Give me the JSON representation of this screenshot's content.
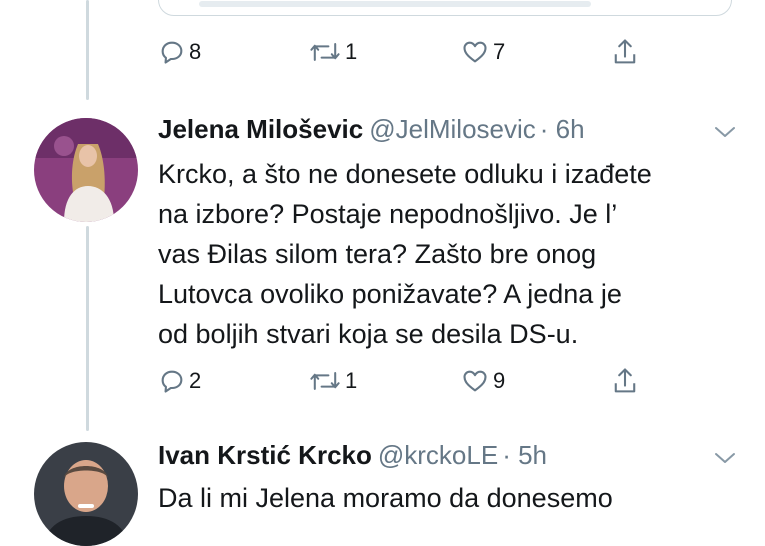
{
  "top_actions": {
    "replies": "8",
    "retweets": "1",
    "likes": "7"
  },
  "tweet1": {
    "name": "Jelena Miloševic",
    "handle": "@JelMilosevic",
    "time": "· 6h",
    "lines": [
      "Krcko, a što ne donesete odluku i izađete",
      "na izbore? Postaje nepodnošljivo. Je l’",
      "vas Đilas silom tera? Zašto bre onog",
      "Lutovca ovoliko ponižavate? A jedna je",
      "od boljih stvari koja se desila DS-u."
    ],
    "replies": "2",
    "retweets": "1",
    "likes": "9"
  },
  "tweet2": {
    "name": "Ivan Krstić Krcko",
    "handle": "@krckoLE",
    "time": "· 5h",
    "lines": [
      "Da li mi Jelena moramo da donesemo"
    ]
  },
  "colors": {
    "icon": "#657786",
    "text": "#14171a",
    "line": "#cfd9de"
  },
  "icons": [
    "reply-icon",
    "retweet-icon",
    "like-icon",
    "share-icon",
    "chevron-down-icon"
  ]
}
